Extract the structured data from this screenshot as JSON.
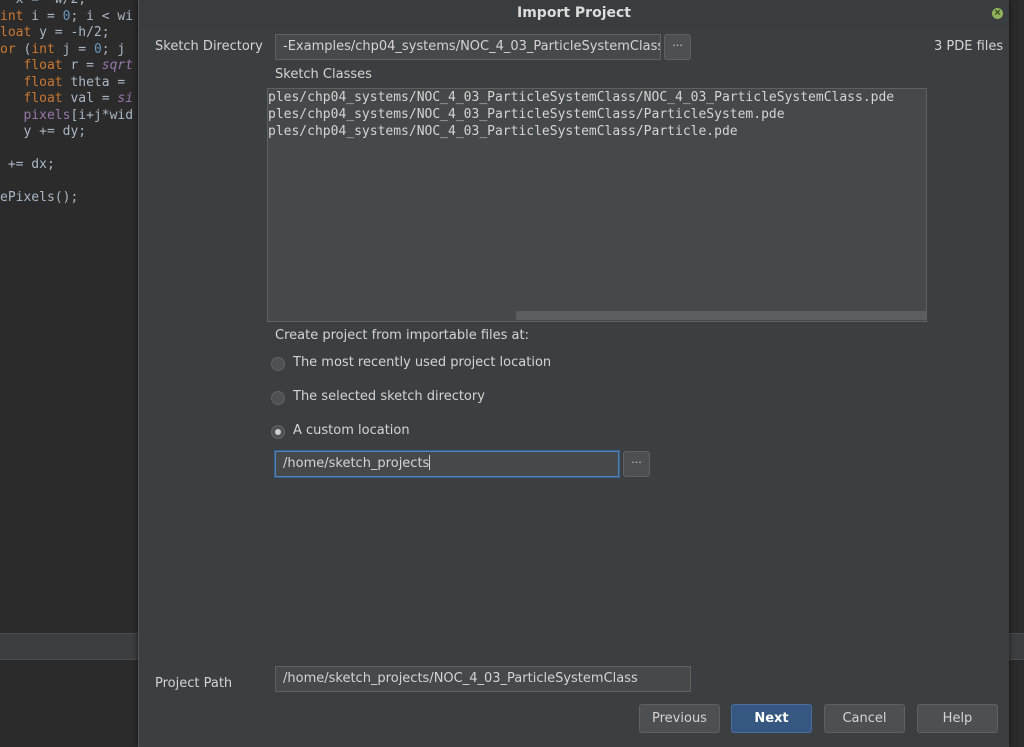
{
  "editor": {
    "lines": [
      {
        "parts": [
          [
            "pl",
            "  x = -w/2;"
          ]
        ]
      },
      {
        "parts": [
          [
            "kw",
            "int"
          ],
          [
            "pl",
            " i = "
          ],
          [
            "num",
            "0"
          ],
          [
            "pl",
            "; i < wi"
          ]
        ]
      },
      {
        "parts": [
          [
            "kw",
            "loat"
          ],
          [
            "pl",
            " y = -h/2;"
          ]
        ]
      },
      {
        "parts": [
          [
            "kw",
            "or"
          ],
          [
            "pl",
            " ("
          ],
          [
            "kw",
            "int"
          ],
          [
            "pl",
            " j = "
          ],
          [
            "num",
            "0"
          ],
          [
            "pl",
            "; j"
          ]
        ]
      },
      {
        "parts": [
          [
            "pl",
            "   "
          ],
          [
            "kw",
            "float"
          ],
          [
            "pl",
            " r = "
          ],
          [
            "fn",
            "sqrt"
          ]
        ]
      },
      {
        "parts": [
          [
            "pl",
            "   "
          ],
          [
            "kw",
            "float"
          ],
          [
            "pl",
            " theta ="
          ]
        ]
      },
      {
        "parts": [
          [
            "pl",
            "   "
          ],
          [
            "kw",
            "float"
          ],
          [
            "pl",
            " val = "
          ],
          [
            "fn",
            "si"
          ]
        ]
      },
      {
        "parts": [
          [
            "pl",
            "   "
          ],
          [
            "fld",
            "pixels"
          ],
          [
            "pl",
            "[i+j*wid"
          ]
        ]
      },
      {
        "parts": [
          [
            "pl",
            "   y += dy;"
          ]
        ]
      },
      {
        "parts": [
          [
            "pl",
            ""
          ]
        ]
      },
      {
        "parts": [
          [
            "pl",
            " += dx;"
          ]
        ]
      },
      {
        "parts": [
          [
            "pl",
            ""
          ]
        ]
      },
      {
        "parts": [
          [
            "pl",
            "ePixels();"
          ]
        ]
      }
    ]
  },
  "dialog": {
    "title": "Import Project",
    "sketch_directory_label": "Sketch Directory",
    "sketch_directory_value": "-Examples/chp04_systems/NOC_4_03_ParticleSystemClass",
    "browse_label": "···",
    "file_count": "3 PDE files",
    "sketch_classes_label": "Sketch Classes",
    "sketch_classes": [
      "ples/chp04_systems/NOC_4_03_ParticleSystemClass/NOC_4_03_ParticleSystemClass.pde",
      "ples/chp04_systems/NOC_4_03_ParticleSystemClass/ParticleSystem.pde",
      "ples/chp04_systems/NOC_4_03_ParticleSystemClass/Particle.pde"
    ],
    "create_from_label": "Create project from importable files at:",
    "options": [
      {
        "label": "The most recently used project location",
        "selected": false
      },
      {
        "label": "The selected sketch directory",
        "selected": false
      },
      {
        "label": "A custom location",
        "selected": true
      }
    ],
    "custom_location_value": "/home/sketch_projects",
    "project_path_label": "Project Path",
    "project_path_value": "/home/sketch_projects/NOC_4_03_ParticleSystemClass",
    "buttons": {
      "previous": "Previous",
      "next": "Next",
      "cancel": "Cancel",
      "help": "Help"
    }
  }
}
